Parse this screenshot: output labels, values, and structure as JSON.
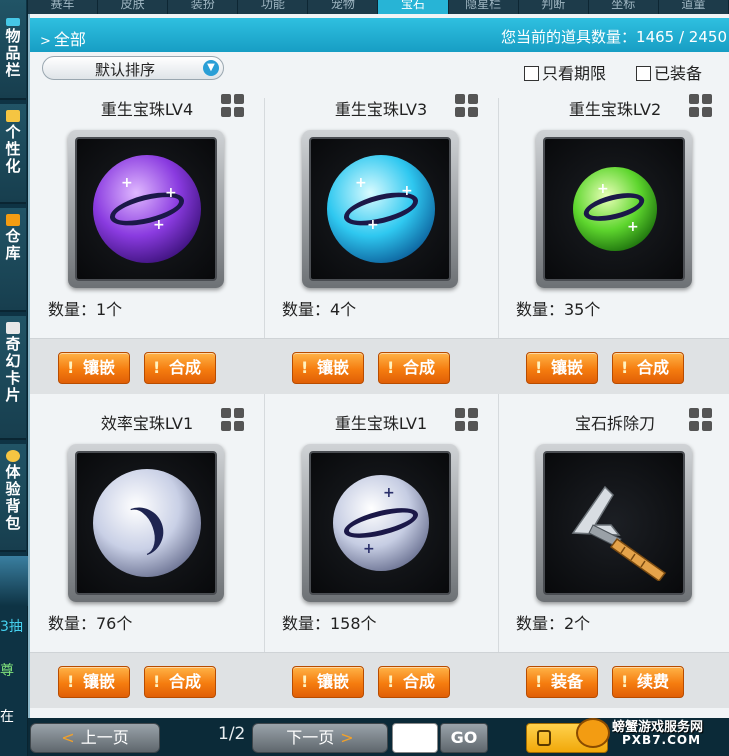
{
  "top_tabs": [
    "赛车",
    "皮肤",
    "装扮",
    "功能",
    "宠物",
    "宝石",
    "隐星栏",
    "判断",
    "坐标",
    "道童"
  ],
  "active_tab_index": 5,
  "sidebar": {
    "items": [
      {
        "label": "物品栏",
        "icon": "bag-icon"
      },
      {
        "label": "个性化",
        "icon": "star-icon"
      },
      {
        "label": "仓库",
        "icon": "house-icon"
      },
      {
        "label": "奇幻卡片",
        "icon": "card-icon"
      },
      {
        "label": "体验背包",
        "icon": "lock-icon"
      }
    ],
    "fragments": [
      "3抽",
      "尊",
      "在"
    ]
  },
  "header": {
    "filter_label": "全部",
    "count_text": "您当前的道具数量：1465 / 2450"
  },
  "sort": {
    "label": "默认排序"
  },
  "checkboxes": [
    {
      "label": "只看期限",
      "checked": false
    },
    {
      "label": "已装备",
      "checked": false
    }
  ],
  "items": [
    {
      "name": "重生宝珠LV4",
      "qty": "数量：1个",
      "gem": "purple",
      "btn1": "镶嵌",
      "btn2": "合成"
    },
    {
      "name": "重生宝珠LV3",
      "qty": "数量：4个",
      "gem": "cyan",
      "btn1": "镶嵌",
      "btn2": "合成"
    },
    {
      "name": "重生宝珠LV2",
      "qty": "数量：35个",
      "gem": "green",
      "btn1": "镶嵌",
      "btn2": "合成"
    },
    {
      "name": "效率宝珠LV1",
      "qty": "数量：76个",
      "gem": "silver-swirl",
      "btn1": "镶嵌",
      "btn2": "合成"
    },
    {
      "name": "重生宝珠LV1",
      "qty": "数量：158个",
      "gem": "silver",
      "btn1": "镶嵌",
      "btn2": "合成"
    },
    {
      "name": "宝石拆除刀",
      "qty": "数量：2个",
      "gem": "knife",
      "btn1": "装备",
      "btn2": "续费"
    }
  ],
  "pagination": {
    "prev": "上一页",
    "indicator": "1/2",
    "next": "下一页",
    "go": "GO"
  },
  "watermark": {
    "text": "螃蟹游戏服务网",
    "url": "PXB7.COM"
  }
}
